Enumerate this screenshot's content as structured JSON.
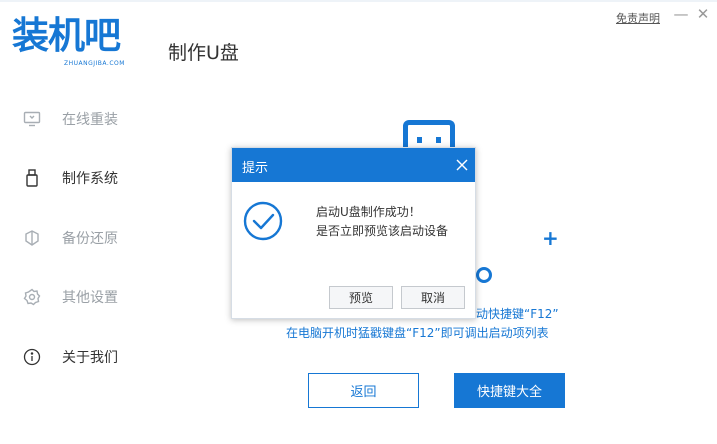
{
  "app": {
    "logo_text": "装机吧",
    "logo_subtext": "ZHUANGJIBA.COM",
    "page_title": "制作U盘",
    "disclaimer_link": "免责声明",
    "minimize_glyph": "—",
    "close_glyph": "✕"
  },
  "sidebar": {
    "items": [
      {
        "label": "在线重装",
        "icon": "monitor-icon",
        "state": "muted"
      },
      {
        "label": "制作系统",
        "icon": "usb-drive-icon",
        "state": "active"
      },
      {
        "label": "备份还原",
        "icon": "backup-restore-icon",
        "state": "muted"
      },
      {
        "label": "其他设置",
        "icon": "gear-icon",
        "state": "muted"
      },
      {
        "label": "关于我们",
        "icon": "info-icon",
        "state": "active"
      }
    ]
  },
  "main": {
    "hint_line1": "动快捷键“F12”",
    "hint_line2": "在电脑开机时猛戳键盘“F12”即可调出启动项列表",
    "back_button": "返回",
    "shortcuts_button": "快捷键大全"
  },
  "dialog": {
    "title": "提示",
    "message_line1": "启动U盘制作成功！",
    "message_line2": "是否立即预览该启动设备",
    "preview_button": "预览",
    "cancel_button": "取消"
  },
  "colors": {
    "accent": "#1677d4",
    "muted_text": "#9aa0a6"
  }
}
